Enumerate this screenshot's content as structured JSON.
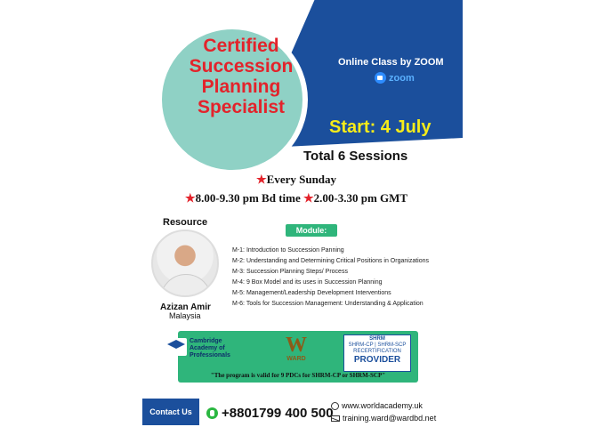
{
  "title_lines": [
    "Certified",
    "Succession",
    "Planning",
    "Specialist"
  ],
  "online_class": "Online Class by ZOOM",
  "zoom_label": "zoom",
  "start": "Start: 4 July",
  "total_sessions": "Total 6 Sessions",
  "schedule": {
    "day": "Every Sunday",
    "time_bd": "8.00-9.30 pm Bd time",
    "time_gmt": "2.00-3.30 pm GMT"
  },
  "resource": {
    "label": "Resource",
    "name": "Azizan Amir",
    "country": "Malaysia"
  },
  "module_label": "Module:",
  "modules": [
    "M-1: Introduction to Succession Panning",
    "M-2: Understanding and Determining Critical Positions in Organizations",
    "M-3: Succession Planning Steps/ Process",
    "M-4: 9 Box Model and its uses in Succession Planning",
    "M-5: Management/Leadership Development Interventions",
    "M-6: Tools for Succession Management: Understanding & Application"
  ],
  "partners": {
    "cap_lines": [
      "Cambridge",
      "Academy of",
      "Professionals"
    ],
    "ward_mark": "W",
    "ward_name": "WARD",
    "shrm_top": "SHRM",
    "shrm_sub": "SHRM-CP | SHRM-SCP",
    "shrm_recert": "RECERTIFICATION",
    "shrm_provider": "PROVIDER",
    "note": "\"The program is valid for 9 PDCs for SHRM-CP or SHRM-SCP\""
  },
  "contact": {
    "button": "Contact Us",
    "phone": "+8801799 400 500",
    "website": "www.worldacademy.uk",
    "email": "training.ward@wardbd.net"
  },
  "colors": {
    "brand_blue": "#1b4f9c",
    "brand_green": "#2fb57b",
    "title_red": "#e3232b",
    "start_yellow": "#f6ec19"
  }
}
